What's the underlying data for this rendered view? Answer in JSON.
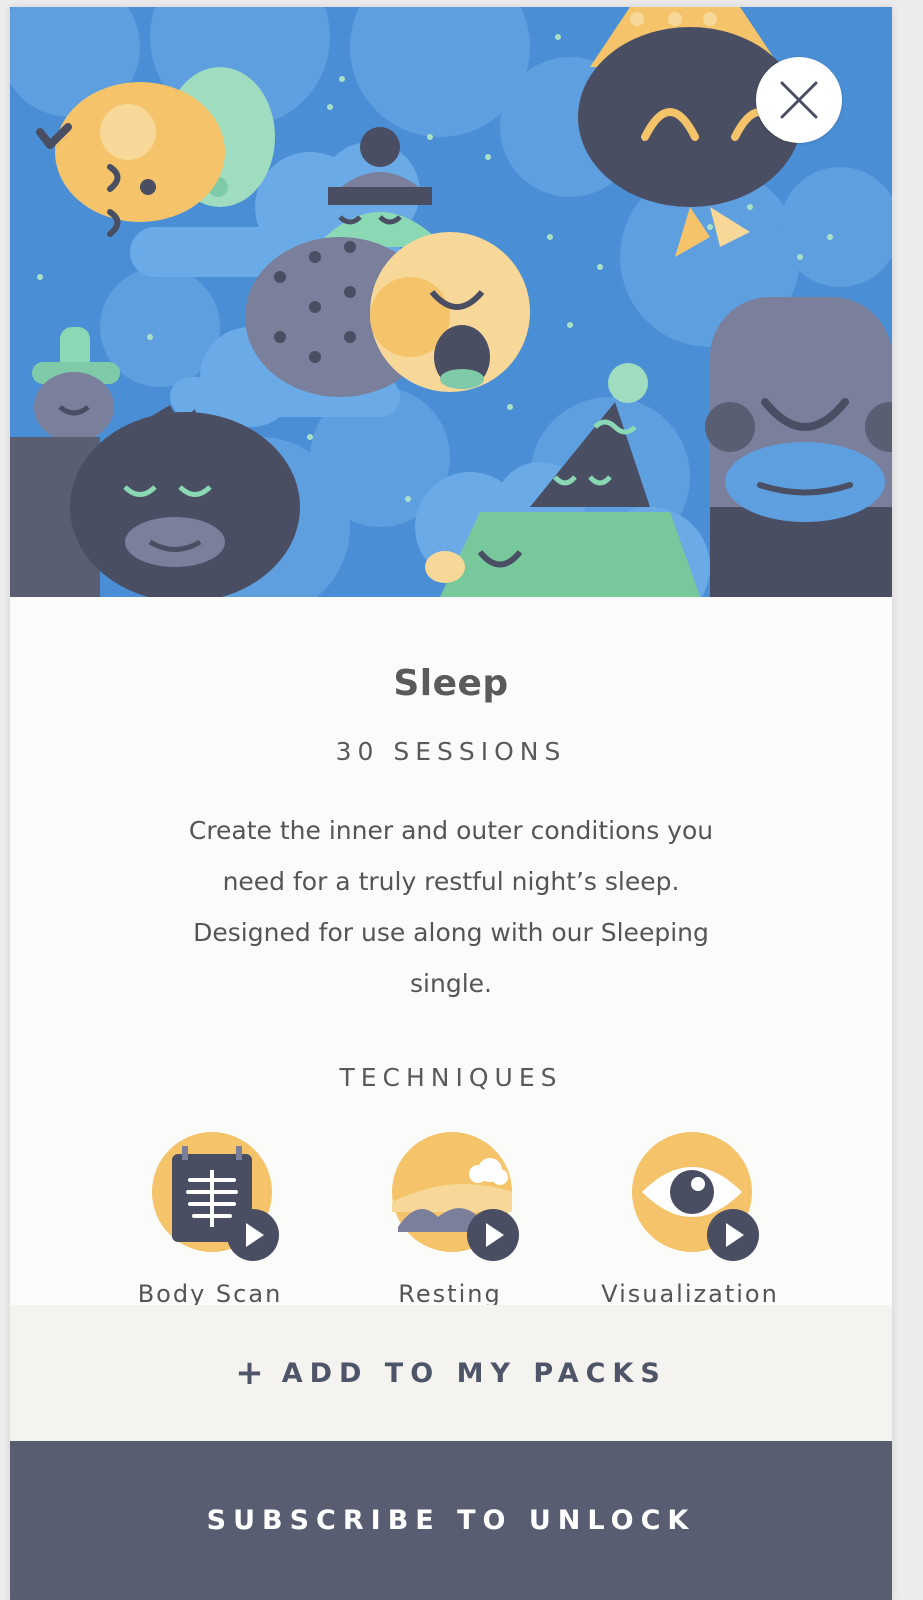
{
  "pack": {
    "title": "Sleep",
    "sessions": "30 SESSIONS",
    "description": "Create the inner and outer conditions you need for a truly restful night’s sleep. Designed for use along with our Sleeping single."
  },
  "techniques": {
    "heading": "TECHNIQUES",
    "items": [
      {
        "label": "Body Scan",
        "icon": "x-ray-icon"
      },
      {
        "label": "Resting",
        "icon": "landscape-icon"
      },
      {
        "label": "Visualization",
        "icon": "eye-icon"
      }
    ]
  },
  "actions": {
    "add_plus": "+",
    "add_label": "ADD TO MY PACKS",
    "subscribe_label": "SUBSCRIBE TO UNLOCK"
  },
  "colors": {
    "hero_sky": "#4a8fd6",
    "accent_yellow": "#f5c46a",
    "dark_navy": "#4a4e62",
    "subscribe_bar": "#595d72",
    "add_bar": "#f4f3f0"
  }
}
